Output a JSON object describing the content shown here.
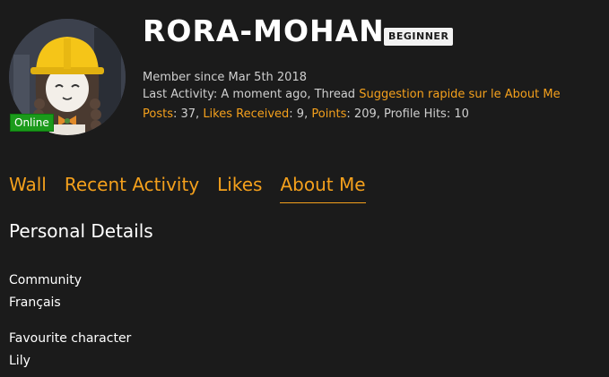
{
  "profile": {
    "username": "RORA-MOHAN",
    "rank": "BEGINNER",
    "online_label": "Online",
    "member_since": "Member since Mar 5th 2018",
    "last_activity_prefix": "Last Activity: A moment ago, Thread ",
    "last_activity_thread": "Suggestion rapide sur le About Me",
    "stats": {
      "posts_label": "Posts",
      "posts_value": ": 37, ",
      "likes_label": "Likes Received",
      "likes_value": ": 9, ",
      "points_label": "Points",
      "points_value": ": 209, Profile Hits: 10"
    }
  },
  "tabs": [
    {
      "label": "Wall"
    },
    {
      "label": "Recent Activity"
    },
    {
      "label": "Likes"
    },
    {
      "label": "About Me",
      "active": true
    }
  ],
  "personal": {
    "title": "Personal Details",
    "fields": [
      {
        "label": "Community",
        "value": "Français"
      },
      {
        "label": "Favourite character",
        "value": "Lily"
      }
    ]
  },
  "colors": {
    "background": "#1b1b1b",
    "accent": "#f4a01c",
    "online": "#1b9a1b"
  }
}
